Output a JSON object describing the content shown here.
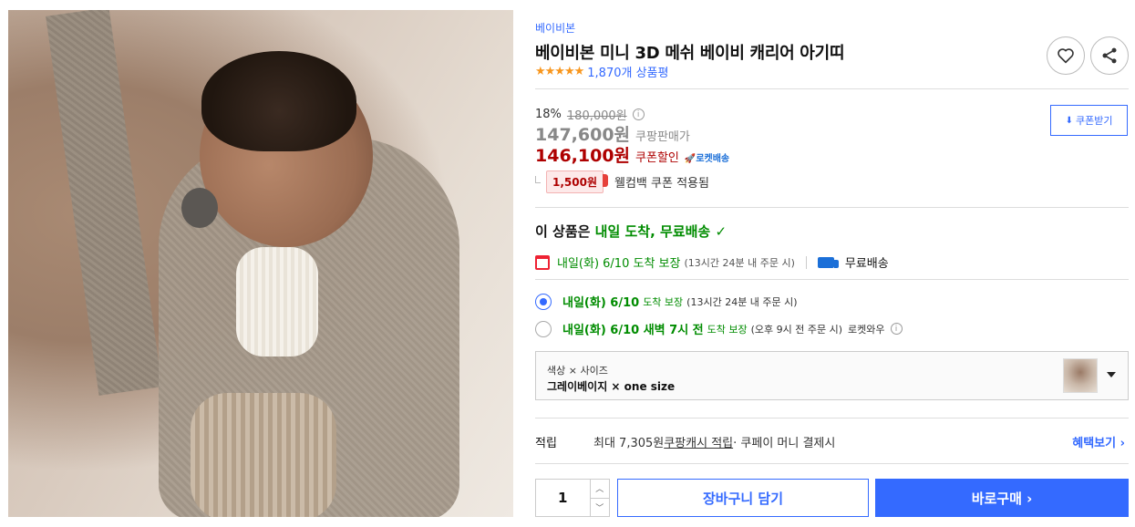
{
  "product": {
    "brand": "베이비본",
    "title": "베이비본 미니 3D 메쉬 베이비 캐리어 아기띠",
    "stars": "★★★★★",
    "review_count": "1,870개 상품평"
  },
  "price": {
    "discount_rate": "18%",
    "original_price": "180,000원",
    "info_icon": "i",
    "sale_price": "147,600원",
    "sale_label": "쿠팡판매가",
    "coupon_price": "146,100원",
    "coupon_label": "쿠폰할인",
    "rocket_label": "로켓배송",
    "coupon_button": "쿠폰받기",
    "cashback_amount": "1,500원",
    "cashback_text": "웰컴백 쿠폰 적용됨"
  },
  "delivery": {
    "headline_prefix": "이 상품은 ",
    "headline_green": "내일 도착, 무료배송",
    "headline_check": "✓",
    "guarantee_date": "내일(화) 6/10 도착 보장",
    "guarantee_cutoff": "(13시간 24분 내 주문 시)",
    "free_shipping": "무료배송",
    "options": [
      {
        "date": "내일(화) 6/10",
        "guarantee": "도착 보장",
        "note": "(13시간 24분 내 주문 시)",
        "extra": "",
        "selected": true
      },
      {
        "date": "내일(화) 6/10 새벽 7시 전",
        "guarantee": "도착 보장",
        "note": "(오후 9시 전 주문 시)",
        "extra": "로켓와우",
        "selected": false
      }
    ]
  },
  "option_select": {
    "label": "색상 × 사이즈",
    "value": "그레이베이지 × one size"
  },
  "reward": {
    "label": "적립",
    "prefix": "최대 7,305원 ",
    "link": "쿠팡캐시 적립",
    "suffix": " · 쿠페이 머니 결제시",
    "benefit": "혜택보기 ›"
  },
  "purchase": {
    "quantity": "1",
    "qty_up": "︿",
    "qty_down": "﹀",
    "cart": "장바구니 담기",
    "buy": "바로구매 ›"
  },
  "icons": {
    "heart": "heart-icon",
    "share": "share-icon"
  },
  "colors": {
    "accent": "#346aff",
    "sale_red": "#ae0000",
    "green": "#008c00",
    "star": "#f8961d"
  }
}
